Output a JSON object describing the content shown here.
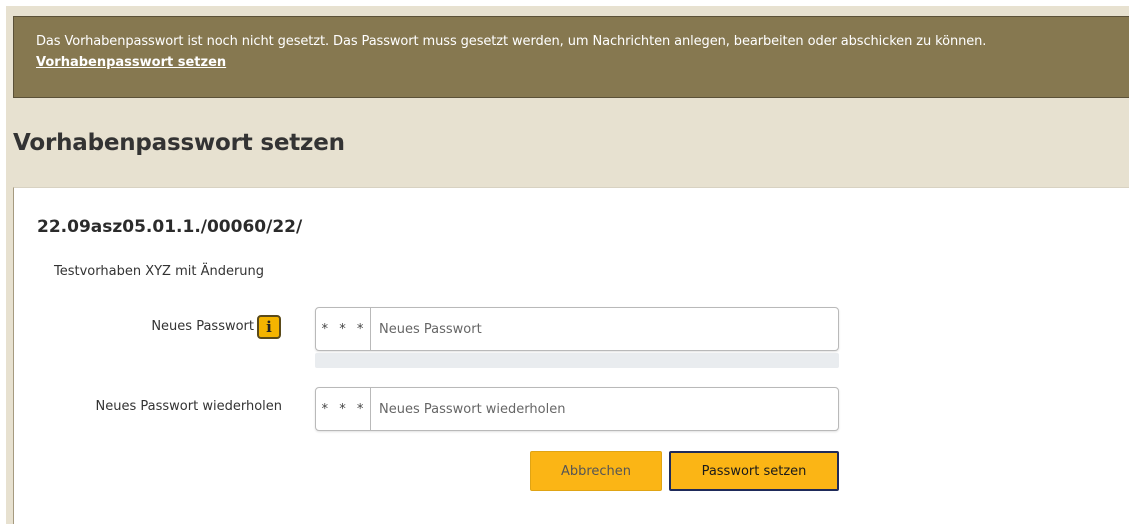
{
  "alert": {
    "message": "Das Vorhabenpasswort ist noch nicht gesetzt. Das Passwort muss gesetzt werden, um Nachrichten anlegen, bearbeiten oder abschicken zu können.",
    "link": "Vorhabenpasswort setzen"
  },
  "page": {
    "title": "Vorhabenpasswort setzen"
  },
  "form": {
    "reference_number": "22.09asz05.01.1./00060/22/",
    "project_name": "Testvorhaben XYZ mit Änderung",
    "new_password": {
      "label": "Neues Passwort",
      "addon": "* * *",
      "placeholder": "Neues Passwort",
      "value": "",
      "info_icon": "info-icon"
    },
    "strength": 0,
    "repeat_password": {
      "label": "Neues Passwort wiederholen",
      "addon": "* * *",
      "placeholder": "Neues Passwort wiederholen",
      "value": ""
    },
    "cancel_label": "Abbrechen",
    "submit_label": "Passwort setzen"
  },
  "colors": {
    "alert_bg": "#867850",
    "page_bg": "#e7e1d0",
    "button_bg": "#fbb515",
    "submit_border": "#1e2a5a"
  }
}
